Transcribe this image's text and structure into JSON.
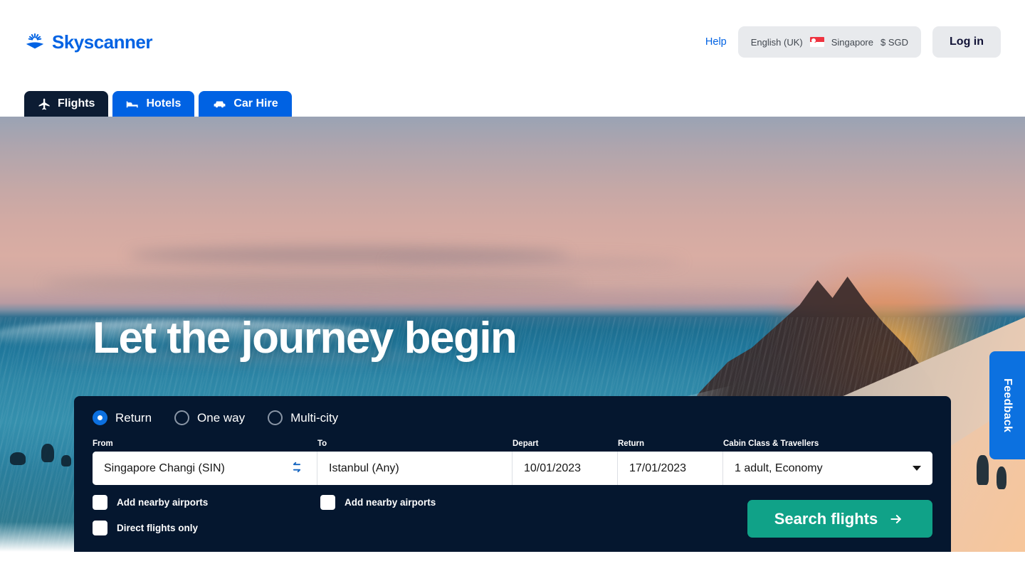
{
  "header": {
    "brand_name": "Skyscanner",
    "logo_icon": "skyscanner-sunburst-logo",
    "help_label": "Help",
    "locale": {
      "language": "English (UK)",
      "flag_icon": "singapore-flag-icon",
      "country": "Singapore",
      "currency": "$ SGD"
    },
    "login_label": "Log in",
    "tabs": [
      {
        "label": "Flights",
        "icon": "plane-icon",
        "active": true
      },
      {
        "label": "Hotels",
        "icon": "bed-icon",
        "active": false
      },
      {
        "label": "Car Hire",
        "icon": "car-icon",
        "active": false
      }
    ]
  },
  "hero": {
    "title": "Let the journey begin"
  },
  "search": {
    "trip_types": [
      {
        "label": "Return",
        "selected": true
      },
      {
        "label": "One way",
        "selected": false
      },
      {
        "label": "Multi-city",
        "selected": false
      }
    ],
    "labels": {
      "from": "From",
      "to": "To",
      "depart": "Depart",
      "return": "Return",
      "cabin": "Cabin Class & Travellers"
    },
    "values": {
      "from": "Singapore Changi (SIN)",
      "to": "Istanbul (Any)",
      "depart": "10/01/2023",
      "return": "17/01/2023",
      "cabin": "1 adult, Economy"
    },
    "swap_icon": "swap-arrows-icon",
    "cabin_chevron_icon": "chevron-down-icon",
    "checkboxes": {
      "nearby_from": "Add nearby airports",
      "nearby_to": "Add nearby airports",
      "direct_only": "Direct flights only"
    },
    "search_button": "Search flights",
    "search_button_icon": "arrow-right-icon"
  },
  "feedback": {
    "label": "Feedback"
  },
  "colors": {
    "brand_blue": "#0062e3",
    "tab_active": "#0c1c33",
    "panel_navy": "#05172f",
    "cta_teal": "#10a288",
    "radio_blue": "#0c70e0"
  }
}
